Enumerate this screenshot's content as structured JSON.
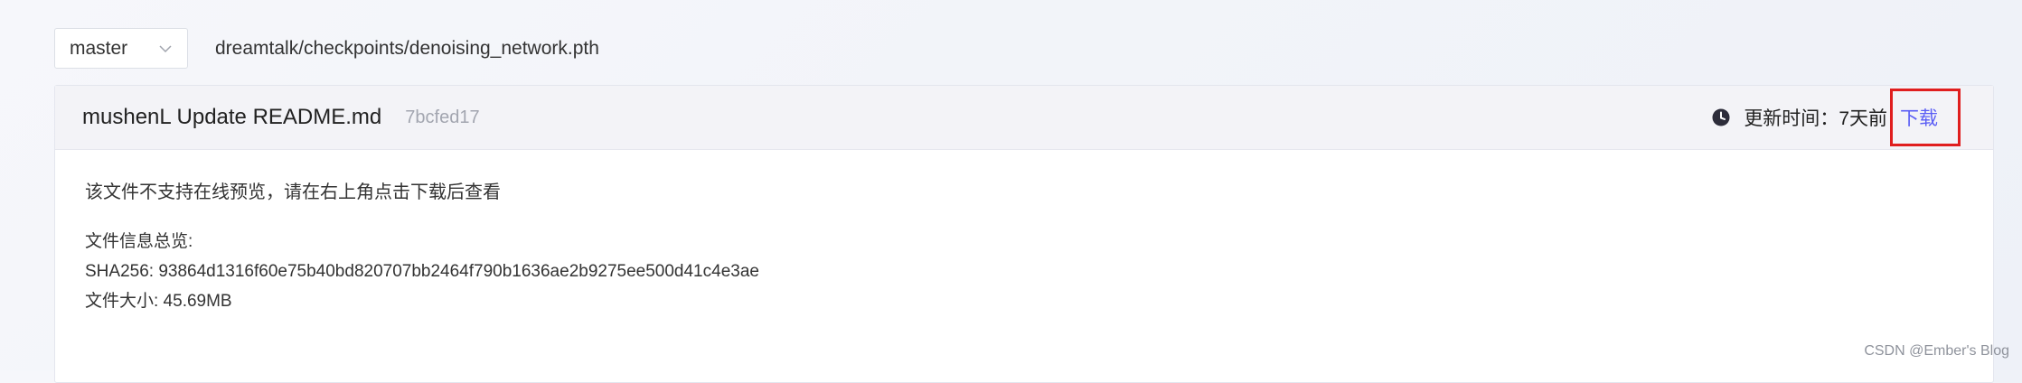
{
  "toolbar": {
    "branch": "master",
    "file_path": "dreamtalk/checkpoints/denoising_network.pth"
  },
  "commit": {
    "message": "mushenL Update README.md",
    "hash": "7bcfed17",
    "updated_label": "更新时间：",
    "updated_value": "7天前",
    "download_label": "下载"
  },
  "file": {
    "no_preview_notice": "该文件不支持在线预览，请在右上角点击下载后查看",
    "info_title": "文件信息总览:",
    "sha256": "SHA256: 93864d1316f60e75b40bd820707bb2464f790b1636ae2b9275ee500d41c4e3ae",
    "size": "文件大小: 45.69MB"
  },
  "watermark": "CSDN @Ember's Blog",
  "colors": {
    "link": "#5b5ef5",
    "highlight_border": "#e01e1e",
    "header_bg": "#f3f3f7"
  },
  "icons": {
    "branch_dropdown": "chevron-down-icon",
    "updated_time": "clock-icon"
  }
}
